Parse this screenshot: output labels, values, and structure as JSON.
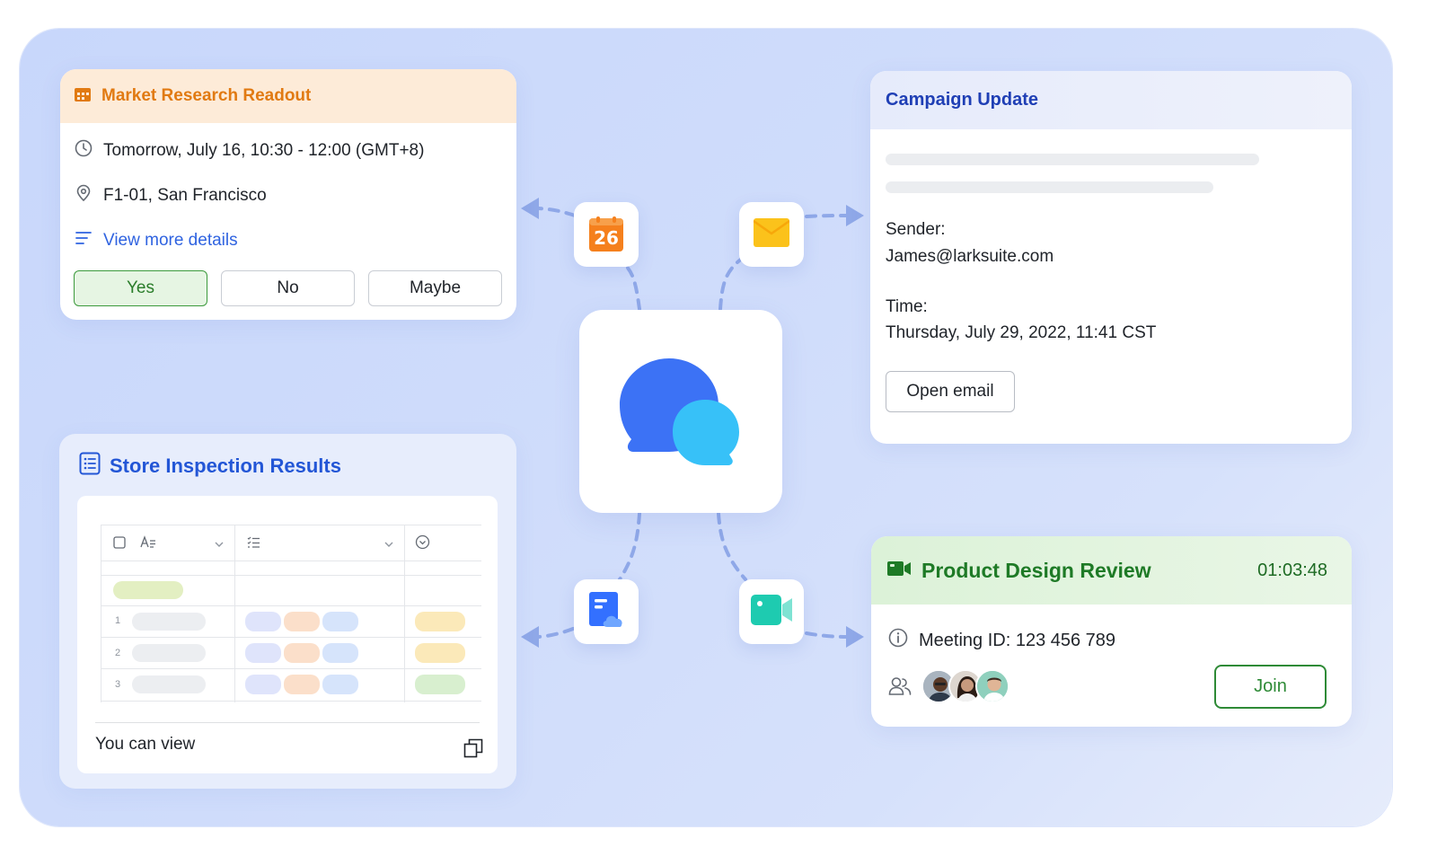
{
  "market_research": {
    "title": "Market Research Readout",
    "time": "Tomorrow, July 16, 10:30 - 12:00 (GMT+8)",
    "location": "F1-01, San Francisco",
    "details_link": "View more details",
    "buttons": {
      "yes": "Yes",
      "no": "No",
      "maybe": "Maybe"
    },
    "icon": "calendar-icon"
  },
  "campaign_update": {
    "title": "Campaign Update",
    "sender_label": "Sender:",
    "sender_value": "James@larksuite.com",
    "time_label": "Time:",
    "time_value": "Thursday, July 29, 2022, 11:41 CST",
    "open_button": "Open email"
  },
  "store_inspection": {
    "title": "Store Inspection Results",
    "row_numbers": [
      "1",
      "2",
      "3"
    ],
    "footer": "You can view",
    "icon": "sheet-list-icon"
  },
  "product_review": {
    "title": "Product Design Review",
    "duration": "01:03:48",
    "meeting_id": "Meeting ID: 123 456 789",
    "join_button": "Join",
    "icon": "video-camera-icon"
  },
  "apps": {
    "calendar_date": "26",
    "icons": [
      "calendar-app-icon",
      "mail-app-icon",
      "docs-app-icon",
      "video-app-icon",
      "chat-bubbles-icon"
    ]
  },
  "colors": {
    "panel_bg": "#cfdcfb",
    "orange_accent": "#e17a12",
    "blue_accent": "#2356d6",
    "green_accent": "#2e8a36",
    "navy_title": "#1f3fb5"
  }
}
